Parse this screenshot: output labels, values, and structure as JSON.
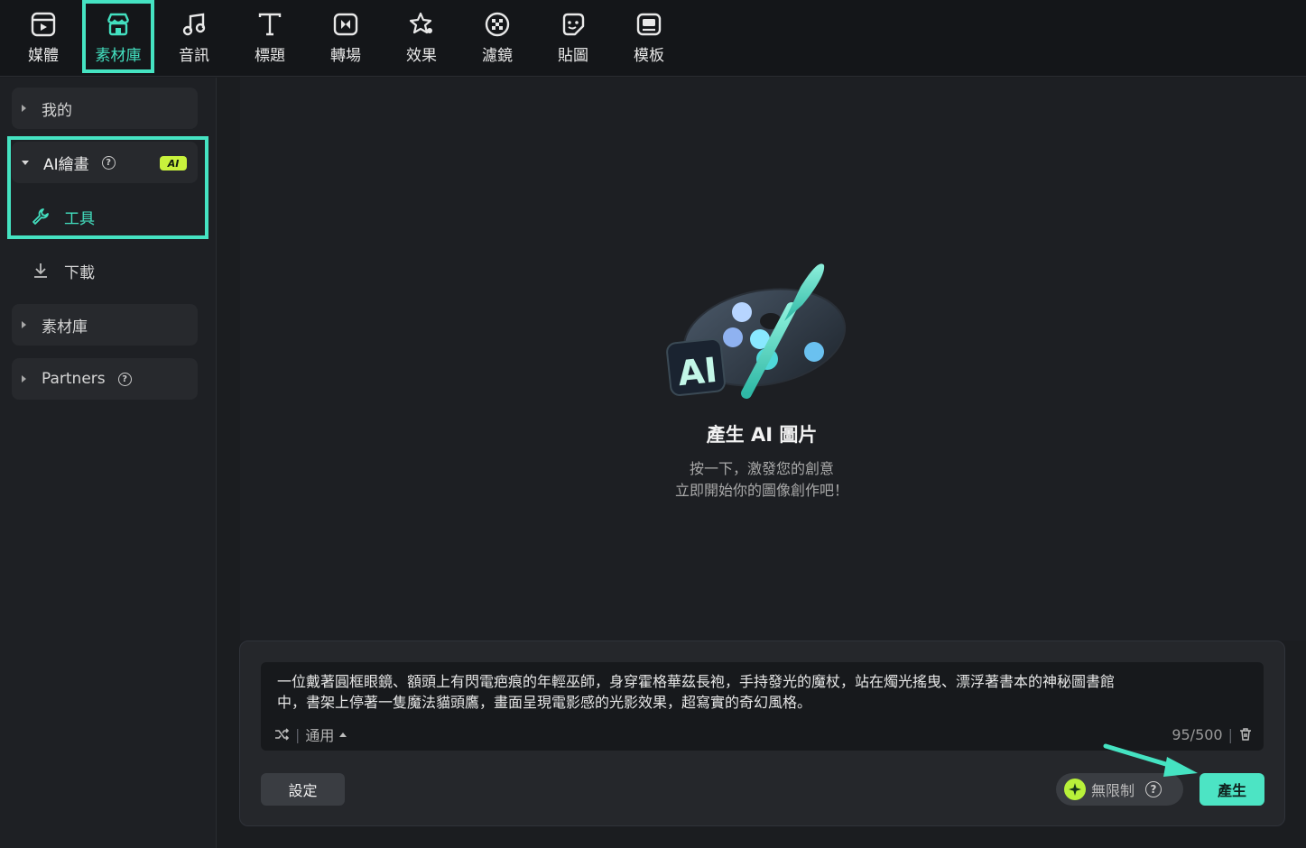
{
  "toolbar": {
    "tabs": [
      {
        "label": "媒體",
        "icon": "media-icon"
      },
      {
        "label": "素材庫",
        "icon": "store-icon"
      },
      {
        "label": "音訊",
        "icon": "music-note-icon"
      },
      {
        "label": "標題",
        "icon": "text-title-icon"
      },
      {
        "label": "轉場",
        "icon": "transition-icon"
      },
      {
        "label": "效果",
        "icon": "effects-star-icon"
      },
      {
        "label": "濾鏡",
        "icon": "filter-icon"
      },
      {
        "label": "貼圖",
        "icon": "sticker-icon"
      },
      {
        "label": "模板",
        "icon": "template-icon"
      }
    ],
    "active_tab": "素材庫"
  },
  "sidebar": {
    "my": "我的",
    "ai_paint": "AI繪畫",
    "ai_badge": "AI",
    "tools": "工具",
    "download": "下載",
    "library": "素材庫",
    "partners": "Partners",
    "help_glyph": "?"
  },
  "hero": {
    "badge": "AI",
    "title": "產生 AI 圖片",
    "line1": "按一下，激發您的創意",
    "line2": "立即開始你的圖像創作吧！"
  },
  "prompt": {
    "text_line1": "一位戴著圓框眼鏡、額頭上有閃電疤痕的年輕巫師，身穿霍格華茲長袍，手持發光的魔杖，站在燭光搖曳、漂浮著書本的神秘圖書館",
    "text_line2": "中，書架上停著一隻魔法貓頭鷹，畫面呈現電影感的光影效果，超寫實的奇幻風格。",
    "style": "通用",
    "count": "95/500"
  },
  "actions": {
    "settings": "設定",
    "credits": "無限制",
    "generate": "產生"
  },
  "colors": {
    "accent": "#45e3c2",
    "ai_badge": "#c8f23c",
    "background": "#1b1d20"
  }
}
